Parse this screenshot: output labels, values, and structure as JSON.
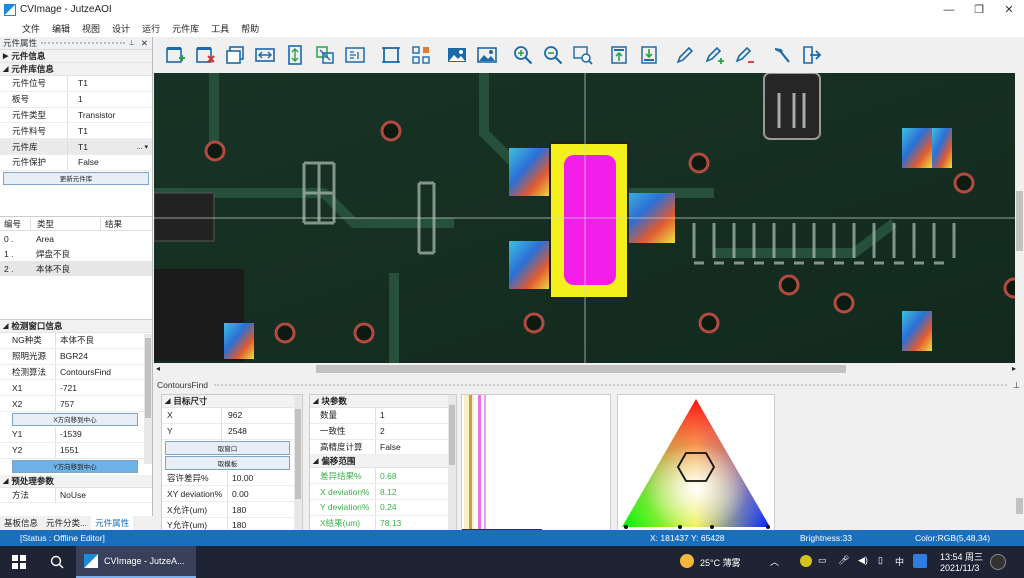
{
  "window": {
    "title": "CVImage - JutzeAOI",
    "minimize": "—",
    "restore": "❐",
    "close": "✕"
  },
  "menu": [
    "文件",
    "编辑",
    "视图",
    "设计",
    "运行",
    "元件库",
    "工具",
    "帮助"
  ],
  "component_props": {
    "pane_title": "元件属性",
    "pin": "📌",
    "close": "✕",
    "group1": "元件信息",
    "group2": "元件库信息",
    "rows": [
      {
        "k": "元件位号",
        "v": "T1"
      },
      {
        "k": "板号",
        "v": "1"
      },
      {
        "k": "元件类型",
        "v": "Transistor"
      },
      {
        "k": "元件料号",
        "v": "T1"
      },
      {
        "k": "元件库",
        "v": "T1"
      },
      {
        "k": "元件保护",
        "v": "False"
      }
    ],
    "lib_dropdown": "... ▾",
    "update_button": "更新元件库"
  },
  "defect_list": {
    "headers": [
      "编号",
      "类型",
      "结果"
    ],
    "rows": [
      {
        "id": "0 .",
        "type": "Area"
      },
      {
        "id": "1 .",
        "type": "焊盘不良"
      },
      {
        "id": "2 .",
        "type": "本体不良"
      }
    ]
  },
  "detect_window": {
    "group": "检测窗口信息",
    "rows": [
      {
        "k": "NG种类",
        "v": "本体不良"
      },
      {
        "k": "照明光源",
        "v": "BGR24"
      },
      {
        "k": "检测算法",
        "v": "ContoursFind"
      },
      {
        "k": "X1",
        "v": "-721"
      },
      {
        "k": "X2",
        "v": "757"
      }
    ],
    "x_center_button": "X方向移到中心",
    "rows2": [
      {
        "k": "Y1",
        "v": "-1539"
      },
      {
        "k": "Y2",
        "v": "1551"
      }
    ],
    "y_center_button": "Y方向移到中心",
    "pre_group": "预处理参数",
    "method_k": "方法",
    "method_v": "NoUse"
  },
  "left_tabs": [
    "基板信息",
    "元件分类...",
    "元件属性"
  ],
  "toolbar_icons": [
    "add-window-icon",
    "delete-window-icon",
    "copy-window-icon",
    "align-horizontal-icon",
    "align-vertical-icon",
    "resize-icon",
    "grid-layout-icon",
    "fit-icon",
    "components-icon",
    "image-icon",
    "image-alt-icon",
    "zoom-in-icon",
    "zoom-out-icon",
    "zoom-fit-icon",
    "move-up-icon",
    "move-down-icon",
    "pen-icon",
    "pen-add-icon",
    "pen-remove-icon",
    "hammer-icon",
    "exit-icon"
  ],
  "algo_panel_title": "ContoursFind",
  "target_size": {
    "group": "目标尺寸",
    "rows": [
      {
        "k": "X",
        "v": "962"
      },
      {
        "k": "Y",
        "v": "2548"
      }
    ],
    "window_button": "取窗口",
    "template_button": "取模板",
    "rows2": [
      {
        "k": "容许差异%",
        "v": "10.00"
      },
      {
        "k": "XY deviation%",
        "v": "0.00"
      },
      {
        "k": "X允许(um)",
        "v": "180"
      },
      {
        "k": "Y允许(um)",
        "v": "180"
      }
    ]
  },
  "block_params": {
    "group": "块参数",
    "rows": [
      {
        "k": "数量",
        "v": "1"
      },
      {
        "k": "一致性",
        "v": "2"
      },
      {
        "k": "高精度计算",
        "v": "False"
      }
    ],
    "offset_group": "偏移范围",
    "offset_rows": [
      {
        "k": "差异结果%",
        "v": "0.68"
      },
      {
        "k": "X deviation%",
        "v": "8.12"
      },
      {
        "k": "Y deviation%",
        "v": "0.24"
      },
      {
        "k": "X结果(um)",
        "v": "78.13"
      }
    ]
  },
  "status": {
    "left": "[Status : Offline Editor]",
    "coords": "X: 181437 Y: 65428",
    "brightness": "Brightness:33",
    "color": "Color:RGB(5,48,34)"
  },
  "taskbar": {
    "app_label": "CVImage - JutzeA...",
    "weather": "25°C 薄雾",
    "time": "13:54 周三",
    "date": "2021/11/3"
  },
  "colors": {
    "accent": "#1a6fbd",
    "selected_button": "#6cb2e6",
    "green_text": "#3cb04a"
  }
}
